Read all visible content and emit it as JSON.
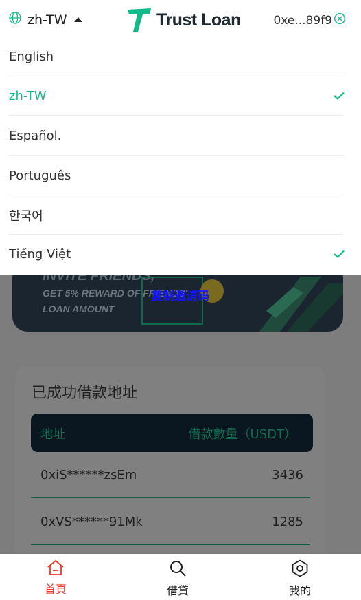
{
  "header": {
    "language": "zh-TW",
    "logo_text": "Trust Loan",
    "wallet_address": "0xe...89f9"
  },
  "language_menu": {
    "items": [
      {
        "label": "English",
        "checked": false,
        "active": false
      },
      {
        "label": "zh-TW",
        "checked": true,
        "active": true
      },
      {
        "label": "Español.",
        "checked": false,
        "active": false
      },
      {
        "label": "Português",
        "checked": false,
        "active": false
      },
      {
        "label": "한국어",
        "checked": false,
        "active": false
      },
      {
        "label": "Tiếng Việt",
        "checked": true,
        "active": false
      }
    ]
  },
  "banner": {
    "line1": "INVITE FRIENDS,",
    "line2": "GET 5% REWARD OF FRIENDS'",
    "line3": "LOAN AMOUNT",
    "link_text": "复制邀请码"
  },
  "loans": {
    "title": "已成功借款地址",
    "col_address": "地址",
    "col_amount": "借款數量（USDT）",
    "rows": [
      {
        "address": "0xiS******zsEm",
        "amount": "3436"
      },
      {
        "address": "0xVS******91Mk",
        "amount": "1285"
      }
    ]
  },
  "tabs": [
    {
      "label": "首頁",
      "icon": "home-icon",
      "active": true
    },
    {
      "label": "借貸",
      "icon": "search-icon",
      "active": false
    },
    {
      "label": "我的",
      "icon": "gear-icon",
      "active": false
    }
  ],
  "colors": {
    "accent": "#14b98a",
    "active_tab": "#e8392c",
    "overlay": "#7d7d7d",
    "table_header": "#0a1720"
  }
}
